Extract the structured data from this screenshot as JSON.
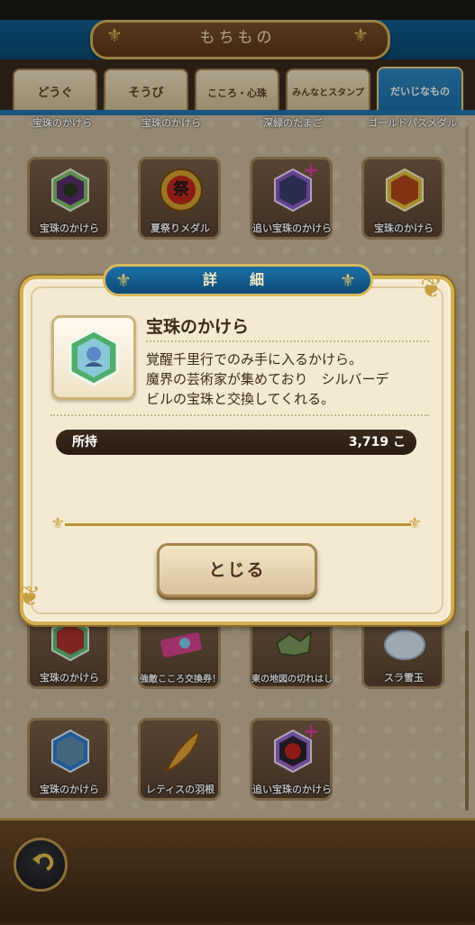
{
  "header": {
    "title": "もちもの"
  },
  "tabs": [
    {
      "label": "どうぐ",
      "active": false
    },
    {
      "label": "そうび",
      "active": false
    },
    {
      "label": "こころ・心珠",
      "active": false
    },
    {
      "label": "みんなとスタンプ",
      "active": false
    },
    {
      "label": "だいじなもの",
      "active": true
    }
  ],
  "grid": {
    "peek_labels": [
      "宝珠のかけら",
      "宝珠のかけら",
      "深緑のたまご",
      "ゴールドパスメダル"
    ],
    "row1": [
      "宝珠のかけら",
      "夏祭りメダル",
      "追い宝珠のかけら",
      "宝珠のかけら"
    ],
    "row_hidden": [
      "宝珠のかけら",
      "強敵こころ交換券！",
      "東の地図の切れはし",
      "スラ雪玉"
    ],
    "row_last": [
      "宝珠のかけら",
      "レティスの羽根",
      "追い宝珠のかけら"
    ],
    "medal_glyph": "祭"
  },
  "modal": {
    "title": "詳　細",
    "item_name": "宝珠のかけら",
    "description_lines": [
      "覚醒千里行でのみ手に入るかけら。",
      "魔界の芸術家が集めており　シルバーデ",
      "ビルの宝珠と交換してくれる。"
    ],
    "own_label": "所持",
    "own_value": "3,719 こ",
    "close_label": "とじる"
  },
  "colors": {
    "header_blue": "#0f5d8e",
    "tab_active": "#2d88c2",
    "gold": "#d3ae52",
    "panel": "#f4ead2"
  },
  "icons": {
    "back": "back-arrow-icon",
    "ornament": "fleur-de-lis-icon"
  }
}
